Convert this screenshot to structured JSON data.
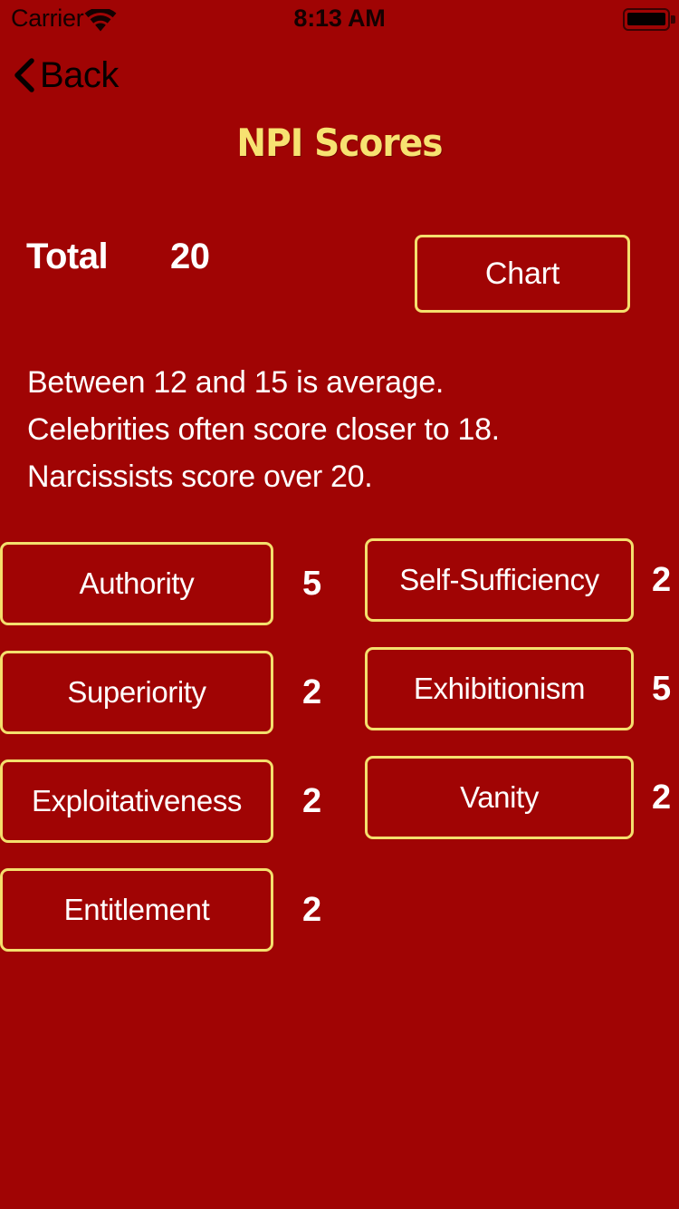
{
  "status_bar": {
    "carrier": "Carrier",
    "time": "8:13 AM",
    "wifi_icon": "wifi-icon",
    "battery_icon": "battery-full-icon"
  },
  "nav_bar": {
    "back_label": "Back",
    "back_icon": "chevron-left-icon"
  },
  "header": {
    "title": "NPI Scores"
  },
  "summary": {
    "total_label": "Total",
    "total_value": "20",
    "chart_button_label": "Chart"
  },
  "description": {
    "lines": [
      "Between 12 and 15 is average.",
      "Celebrities often score closer to 18.",
      "Narcissists score over 20."
    ]
  },
  "colors": {
    "background": "#A00404",
    "accent_border": "#F4DF6D",
    "title": "#F7E271",
    "text": "#FFFFFF",
    "status_text": "#140101"
  },
  "scores": {
    "left_column": [
      {
        "label": "Authority",
        "value": "5"
      },
      {
        "label": "Superiority",
        "value": "2"
      },
      {
        "label": "Exploitativeness",
        "value": "2"
      },
      {
        "label": "Entitlement",
        "value": "2"
      }
    ],
    "right_column": [
      {
        "label": "Self-Sufficiency",
        "value": "2"
      },
      {
        "label": "Exhibitionism",
        "value": "5"
      },
      {
        "label": "Vanity",
        "value": "2"
      }
    ]
  }
}
